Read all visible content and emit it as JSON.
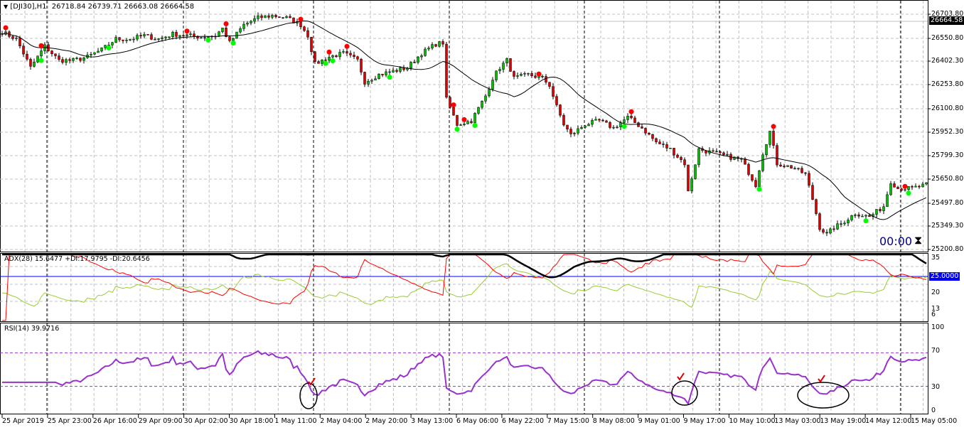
{
  "header": {
    "symbol": "[DJI30],H1",
    "ohlc": "26718.84 26739.71 26663.08 26664.58",
    "menu_icon": "triangle-down-icon"
  },
  "price_axis": {
    "labels": [
      "26703.80",
      "26550.80",
      "26402.30",
      "26253.80",
      "26100.80",
      "25952.30",
      "25799.30",
      "25650.80",
      "25497.80",
      "25349.30",
      "25200.80"
    ],
    "current_price": "26664.58"
  },
  "timer": {
    "text": "00:00",
    "icon": "hourglass-icon"
  },
  "adx_panel": {
    "title": "ADX(28) 15.6477 +DI:17.9795 -DI:20.6456",
    "axis_labels": [
      "35",
      "20",
      "13",
      "6"
    ],
    "level_label": "25.0000",
    "level": 25
  },
  "rsi_panel": {
    "title": "RSI(14) 39.9716",
    "axis_labels": [
      "100",
      "70",
      "30",
      "0"
    ],
    "levels": [
      70,
      30
    ]
  },
  "time_axis": [
    "25 Apr 2019",
    "25 Apr 23:00",
    "26 Apr 16:00",
    "29 Apr 09:00",
    "30 Apr 02:00",
    "30 Apr 18:00",
    "1 May 11:00",
    "2 May 04:00",
    "2 May 20:00",
    "3 May 13:00",
    "6 May 06:00",
    "6 May 22:00",
    "7 May 15:00",
    "8 May 08:00",
    "9 May 01:00",
    "9 May 17:00",
    "10 May 10:00",
    "13 May 03:00",
    "13 May 19:00",
    "14 May 12:00",
    "15 May 05:00"
  ],
  "colors": {
    "bull": "#00c000",
    "bear": "#e00000",
    "adx": "#000000",
    "plus_di": "#9acd32",
    "minus_di": "#ff0000",
    "rsi": "#9932cc",
    "level": "#0000ff",
    "fractal_up": "#ff0000",
    "fractal_down": "#00ff00"
  },
  "chart_data": {
    "type": "candlestick",
    "symbol": "DJI30",
    "timeframe": "H1",
    "ylim": [
      25170,
      26760
    ],
    "close_anchors": {
      "bar": [
        0,
        4,
        8,
        12,
        16,
        20,
        24,
        28,
        32,
        36,
        40,
        44,
        48,
        52,
        56,
        60,
        62,
        64,
        68,
        72,
        76,
        80,
        84,
        86,
        88,
        92,
        96,
        100,
        102,
        106,
        110,
        114,
        118,
        122,
        124,
        125,
        128,
        132,
        136,
        138,
        140,
        142,
        144,
        148,
        152,
        154,
        156,
        158,
        160,
        164,
        168,
        172,
        176,
        180,
        184,
        188,
        192,
        193,
        196,
        200,
        204,
        208,
        212,
        214,
        216,
        218,
        222,
        226,
        228,
        230,
        232,
        234,
        236,
        240,
        244,
        248,
        250,
        252,
        256,
        260
      ],
      "close": [
        26590,
        26545,
        26363,
        26500,
        26409,
        26409,
        26431,
        26477,
        26545,
        26545,
        26568,
        26545,
        26577,
        26568,
        26558,
        26568,
        26613,
        26522,
        26636,
        26681,
        26695,
        26681,
        26636,
        26568,
        26386,
        26431,
        26454,
        26409,
        26272,
        26318,
        26340,
        26363,
        26454,
        26513,
        26522,
        26159,
        26000,
        26023,
        26182,
        26295,
        26363,
        26409,
        26295,
        26318,
        26295,
        26250,
        26113,
        26000,
        25932,
        26000,
        26023,
        25977,
        26045,
        25977,
        25886,
        25841,
        25750,
        25568,
        25841,
        25818,
        25795,
        25773,
        25614,
        25818,
        25954,
        25750,
        25727,
        25682,
        25523,
        25341,
        25296,
        25341,
        25364,
        25432,
        25409,
        25477,
        25636,
        25591,
        25591,
        25614
      ]
    },
    "moving_average_period": 20,
    "fractals_up_bars": [
      1,
      11,
      52,
      63,
      84,
      92,
      97,
      127,
      130,
      151,
      177,
      217,
      254
    ],
    "fractals_down_bars": [
      11,
      30,
      58,
      65,
      91,
      93,
      109,
      128,
      133,
      175,
      213,
      243,
      255
    ],
    "adx_period": 28,
    "rsi_period": 14,
    "annotations": [
      {
        "type": "ellipse",
        "panel": "rsi",
        "bar": 87,
        "rsi": 23
      },
      {
        "type": "ellipse",
        "panel": "rsi",
        "bar": 192,
        "rsi": 26
      },
      {
        "type": "ellipse",
        "panel": "rsi",
        "bar": 231,
        "rsi": 24
      }
    ]
  }
}
